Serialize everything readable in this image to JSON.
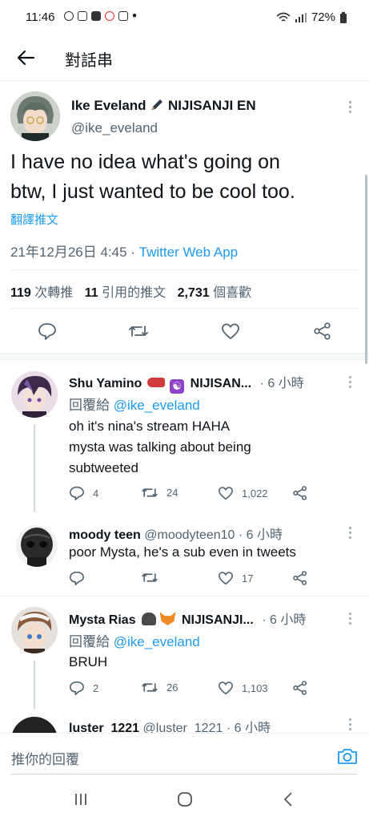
{
  "status": {
    "time": "11:46",
    "battery": "72%"
  },
  "header": {
    "title": "對話串"
  },
  "main_tweet": {
    "name": "Ike Eveland",
    "name_suffix": "NIJISANJI EN",
    "handle": "@ike_eveland",
    "text_line1": "I have no idea what's going on",
    "text_line2": "btw, I just wanted to be cool too.",
    "translate": "翻譯推文",
    "date": "21年12月26日 4:45",
    "sep": " · ",
    "source": "Twitter Web App",
    "retweets_count": "119",
    "retweets_label": "次轉推",
    "quotes_count": "11",
    "quotes_label": "引用的推文",
    "likes_count": "2,731",
    "likes_label": "個喜歡"
  },
  "replies": [
    {
      "name": "Shu Yamino",
      "name_suffix": "NIJISAN...",
      "time": "· 6 小時",
      "reply_prefix": "回覆給",
      "reply_to": "@ike_eveland",
      "text_line1": "oh it's nina's stream HAHA",
      "text_line2": "mysta was talking about being",
      "text_line3": "subtweeted",
      "replies": "4",
      "retweets": "24",
      "likes": "1,022"
    },
    {
      "name": "moody teen",
      "handle": "@moodyteen10",
      "time": "· 6 小時",
      "text_line1": "poor Mysta, he's a sub even in tweets",
      "replies": "",
      "retweets": "",
      "likes": "17"
    },
    {
      "name": "Mysta Rias",
      "name_suffix": "NIJISANJI...",
      "time": "· 6 小時",
      "reply_prefix": "回覆給",
      "reply_to": "@ike_eveland",
      "text_line1": "BRUH",
      "replies": "2",
      "retweets": "26",
      "likes": "1,103"
    },
    {
      "name": "luster_1221",
      "handle": "@luster_1221",
      "time": "· 6 小時"
    }
  ],
  "compose": {
    "placeholder": "推你的回覆"
  },
  "colors": {
    "accent": "#1d9bf0",
    "text": "#0f1419",
    "secondary": "#536471",
    "divider": "#eef1f3"
  }
}
